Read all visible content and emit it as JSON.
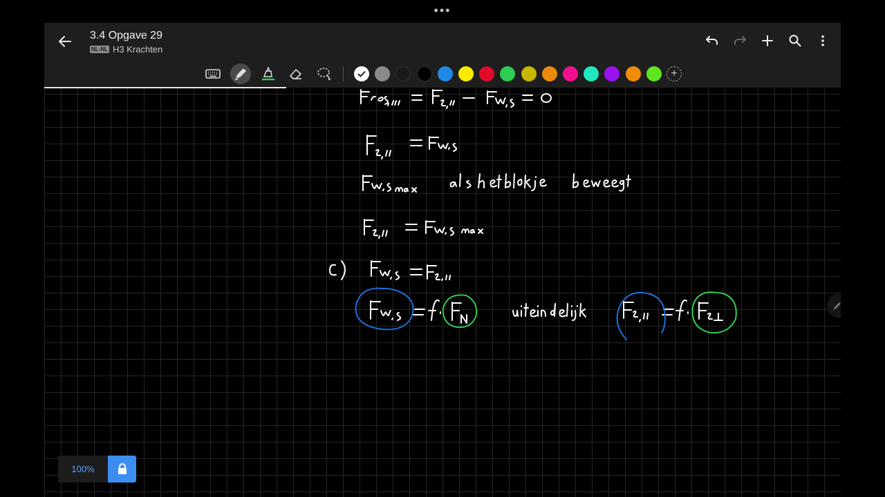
{
  "window": {
    "handle_dots": "•••"
  },
  "header": {
    "title": "3.4 Opgave 29",
    "language_badge": "NL-NL",
    "subtitle": "H3 Krachten",
    "actions": [
      "undo-icon",
      "redo-icon",
      "add-icon",
      "search-icon",
      "more-vertical-icon"
    ]
  },
  "toolbar": {
    "tools": [
      "keyboard-icon",
      "pen-icon",
      "highlighter-icon",
      "eraser-icon",
      "lasso-icon"
    ],
    "active_tool": "pen-icon",
    "colors": [
      "#ffffff",
      "#8a8a8a",
      "#1a1a1a",
      "#000000",
      "#1e88e5",
      "#ffeb00",
      "#e00b2a",
      "#2ecc52",
      "#c9b800",
      "#e88a0c",
      "#f0108f",
      "#1de9c0",
      "#9b11f0",
      "#f28b0c",
      "#5ee51c"
    ],
    "selected_color": "#ffffff",
    "add_color_symbol": "+"
  },
  "canvas": {
    "handwriting": [
      "Fres,// = Fz,// − Fw,s = 0",
      "Fz,// = Fw,s",
      "Fw,s max  als het blokje beweegt",
      "Fz,// = Fw,s max",
      "c)  Fw,s = Fz,//",
      "Fw,s = f · FN    uiteindelijk  Fz,// = f · Fz⊥"
    ],
    "ink_colors": {
      "main": "#ffffff",
      "circle_blue": "#1e6fd9",
      "circle_green": "#2ecc52"
    }
  },
  "footer": {
    "zoom_label": "100%",
    "lock_icon": "lock-icon"
  }
}
